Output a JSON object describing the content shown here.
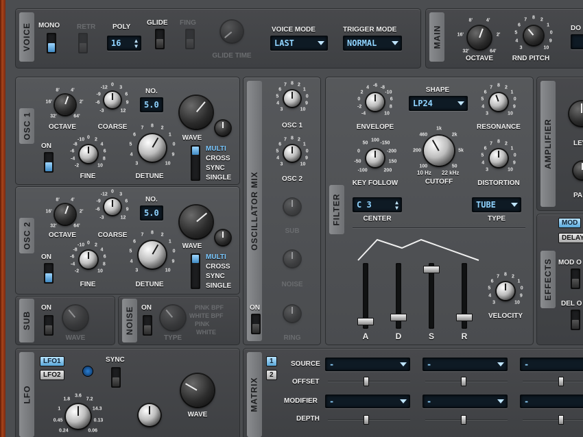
{
  "voice": {
    "title": "VOICE",
    "mono": "MONO",
    "retr": "RETR",
    "poly": "POLY",
    "poly_value": "16",
    "glide": "GLIDE",
    "fing": "FING",
    "glide_time": "GLIDE TIME",
    "voice_mode": "VOICE MODE",
    "voice_mode_value": "LAST",
    "trigger_mode": "TRIGGER MODE",
    "trigger_mode_value": "NORMAL"
  },
  "main": {
    "title": "MAIN",
    "octave": "OCTAVE",
    "rnd_pitch": "RND PITCH",
    "do": "DO"
  },
  "osc1": {
    "title": "OSC 1",
    "octave": "OCTAVE",
    "coarse": "COARSE",
    "no": "NO.",
    "no_value": "5.0",
    "wave": "WAVE",
    "on": "ON",
    "fine": "FINE",
    "detune": "DETUNE",
    "modes": [
      "MULTI",
      "CROSS",
      "SYNC",
      "SINGLE"
    ]
  },
  "osc2": {
    "title": "OSC 2",
    "octave": "OCTAVE",
    "coarse": "COARSE",
    "no": "NO.",
    "no_value": "5.0",
    "wave": "WAVE",
    "on": "ON",
    "fine": "FINE",
    "detune": "DETUNE",
    "modes": [
      "MULTI",
      "CROSS",
      "SYNC",
      "SINGLE"
    ]
  },
  "sub": {
    "title": "SUB",
    "on": "ON",
    "wave": "WAVE"
  },
  "noise": {
    "title": "NOISE",
    "on": "ON",
    "type": "TYPE",
    "types": [
      "PINK BPF",
      "WHITE BPF",
      "PINK",
      "WHITE"
    ]
  },
  "mix": {
    "title": "OSCILLATOR MIX",
    "osc1": "OSC 1",
    "osc2": "OSC 2",
    "sub": "SUB",
    "noise": "NOISE",
    "ring": "RING",
    "on": "ON"
  },
  "filter": {
    "title": "FILTER",
    "shape": "SHAPE",
    "shape_value": "LP24",
    "envelope": "ENVELOPE",
    "resonance": "RESONANCE",
    "key_follow": "KEY FOLLOW",
    "cutoff": "CUTOFF",
    "distortion": "DISTORTION",
    "center": "CENTER",
    "center_value": "C 3",
    "type": "TYPE",
    "type_value": "TUBE",
    "velocity": "VELOCITY",
    "adsr": [
      "A",
      "D",
      "S",
      "R"
    ],
    "cutoff_low": "10 Hz",
    "cutoff_high": "22 kHz"
  },
  "amplifier": {
    "title": "AMPLIFIER",
    "lev": "LEV",
    "pa": "PA"
  },
  "effects": {
    "title": "EFFECTS",
    "mod": "MOD",
    "delay": "DELAY",
    "mod_o": "MOD O",
    "del_o": "DEL O"
  },
  "lfo": {
    "title": "LFO",
    "lfo1": "LFO1",
    "lfo2": "LFO2",
    "sync": "SYNC",
    "wave": "WAVE",
    "rate_ticks": [
      "0.24",
      "0.45",
      "1",
      "1.8",
      "3.6",
      "7.2",
      "14.3",
      "0.13",
      "0.06"
    ]
  },
  "matrix": {
    "title": "MATRIX",
    "page1": "1",
    "page2": "2",
    "source": "SOURCE",
    "offset": "OFFSET",
    "modifier": "MODIFIER",
    "depth": "DEPTH",
    "empty": "-"
  },
  "ticks": {
    "octave": [
      "32'",
      "16'",
      "8'",
      "4'",
      "2'",
      "64'"
    ],
    "coarse": [
      "-3",
      "-6",
      "-9",
      "-12",
      "0",
      "3",
      "6",
      "9",
      "12"
    ],
    "fine": [
      "-2",
      "-4",
      "-6",
      "-8",
      "-10",
      "0",
      "2",
      "4",
      "6",
      "8",
      "10"
    ],
    "detune": [
      "3",
      "4",
      "5",
      "6",
      "7",
      "8",
      "2",
      "1",
      "0",
      "9",
      "10"
    ],
    "rnd": [
      "3",
      "4",
      "5",
      "6",
      "7",
      "8",
      "2",
      "1",
      "0",
      "9",
      "10"
    ],
    "env": [
      "-4",
      "-2",
      "0",
      "2",
      "4",
      "-6",
      "-8",
      "-10",
      "6",
      "8",
      "10"
    ],
    "reso": [
      "3",
      "4",
      "5",
      "6",
      "7",
      "8",
      "2",
      "1",
      "0",
      "9",
      "10"
    ],
    "kf": [
      "-100",
      "-50",
      "0",
      "50",
      "100",
      "-150",
      "-200",
      "150",
      "200"
    ],
    "cutoff": [
      "100",
      "200",
      "460",
      "1k",
      "2k",
      "5k",
      "50"
    ],
    "mix": [
      "3",
      "4",
      "5",
      "6",
      "7",
      "8",
      "2",
      "1",
      "0",
      "9",
      "10"
    ]
  }
}
